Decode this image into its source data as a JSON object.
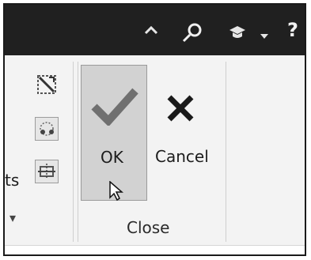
{
  "ribbon": {
    "partial_label": "ts",
    "ok_label": "OK",
    "cancel_label": "Cancel",
    "group_label": "Close",
    "dropdown_glyph": "▾"
  },
  "titlebar": {
    "icons": [
      "chevron-up-icon",
      "search-icon",
      "graduation-cap-icon",
      "chevron-down-icon",
      "help-icon"
    ],
    "help_glyph": "?"
  },
  "colors": {
    "titlebar_bg": "#202020",
    "ribbon_bg": "#f3f3f3",
    "ok_pressed_bg": "#d2d2d2"
  }
}
